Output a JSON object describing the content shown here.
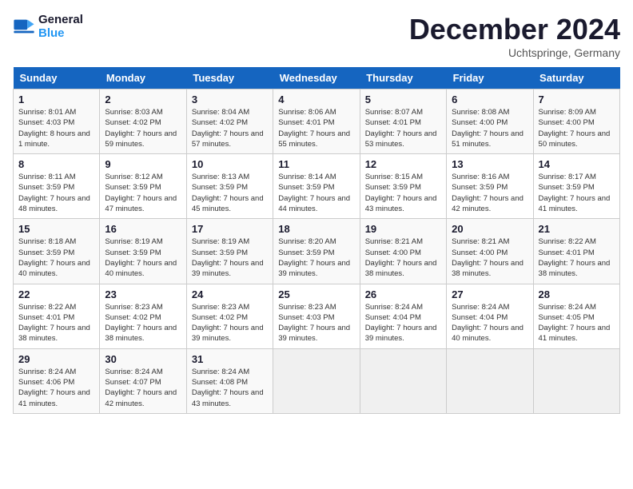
{
  "header": {
    "logo_line1": "General",
    "logo_line2": "Blue",
    "month": "December 2024",
    "location": "Uchtspringe, Germany"
  },
  "days_of_week": [
    "Sunday",
    "Monday",
    "Tuesday",
    "Wednesday",
    "Thursday",
    "Friday",
    "Saturday"
  ],
  "weeks": [
    [
      {
        "day": "1",
        "sunrise": "8:01 AM",
        "sunset": "4:03 PM",
        "daylight": "8 hours and 1 minute."
      },
      {
        "day": "2",
        "sunrise": "8:03 AM",
        "sunset": "4:02 PM",
        "daylight": "7 hours and 59 minutes."
      },
      {
        "day": "3",
        "sunrise": "8:04 AM",
        "sunset": "4:02 PM",
        "daylight": "7 hours and 57 minutes."
      },
      {
        "day": "4",
        "sunrise": "8:06 AM",
        "sunset": "4:01 PM",
        "daylight": "7 hours and 55 minutes."
      },
      {
        "day": "5",
        "sunrise": "8:07 AM",
        "sunset": "4:01 PM",
        "daylight": "7 hours and 53 minutes."
      },
      {
        "day": "6",
        "sunrise": "8:08 AM",
        "sunset": "4:00 PM",
        "daylight": "7 hours and 51 minutes."
      },
      {
        "day": "7",
        "sunrise": "8:09 AM",
        "sunset": "4:00 PM",
        "daylight": "7 hours and 50 minutes."
      }
    ],
    [
      {
        "day": "8",
        "sunrise": "8:11 AM",
        "sunset": "3:59 PM",
        "daylight": "7 hours and 48 minutes."
      },
      {
        "day": "9",
        "sunrise": "8:12 AM",
        "sunset": "3:59 PM",
        "daylight": "7 hours and 47 minutes."
      },
      {
        "day": "10",
        "sunrise": "8:13 AM",
        "sunset": "3:59 PM",
        "daylight": "7 hours and 45 minutes."
      },
      {
        "day": "11",
        "sunrise": "8:14 AM",
        "sunset": "3:59 PM",
        "daylight": "7 hours and 44 minutes."
      },
      {
        "day": "12",
        "sunrise": "8:15 AM",
        "sunset": "3:59 PM",
        "daylight": "7 hours and 43 minutes."
      },
      {
        "day": "13",
        "sunrise": "8:16 AM",
        "sunset": "3:59 PM",
        "daylight": "7 hours and 42 minutes."
      },
      {
        "day": "14",
        "sunrise": "8:17 AM",
        "sunset": "3:59 PM",
        "daylight": "7 hours and 41 minutes."
      }
    ],
    [
      {
        "day": "15",
        "sunrise": "8:18 AM",
        "sunset": "3:59 PM",
        "daylight": "7 hours and 40 minutes."
      },
      {
        "day": "16",
        "sunrise": "8:19 AM",
        "sunset": "3:59 PM",
        "daylight": "7 hours and 40 minutes."
      },
      {
        "day": "17",
        "sunrise": "8:19 AM",
        "sunset": "3:59 PM",
        "daylight": "7 hours and 39 minutes."
      },
      {
        "day": "18",
        "sunrise": "8:20 AM",
        "sunset": "3:59 PM",
        "daylight": "7 hours and 39 minutes."
      },
      {
        "day": "19",
        "sunrise": "8:21 AM",
        "sunset": "4:00 PM",
        "daylight": "7 hours and 38 minutes."
      },
      {
        "day": "20",
        "sunrise": "8:21 AM",
        "sunset": "4:00 PM",
        "daylight": "7 hours and 38 minutes."
      },
      {
        "day": "21",
        "sunrise": "8:22 AM",
        "sunset": "4:01 PM",
        "daylight": "7 hours and 38 minutes."
      }
    ],
    [
      {
        "day": "22",
        "sunrise": "8:22 AM",
        "sunset": "4:01 PM",
        "daylight": "7 hours and 38 minutes."
      },
      {
        "day": "23",
        "sunrise": "8:23 AM",
        "sunset": "4:02 PM",
        "daylight": "7 hours and 38 minutes."
      },
      {
        "day": "24",
        "sunrise": "8:23 AM",
        "sunset": "4:02 PM",
        "daylight": "7 hours and 39 minutes."
      },
      {
        "day": "25",
        "sunrise": "8:23 AM",
        "sunset": "4:03 PM",
        "daylight": "7 hours and 39 minutes."
      },
      {
        "day": "26",
        "sunrise": "8:24 AM",
        "sunset": "4:04 PM",
        "daylight": "7 hours and 39 minutes."
      },
      {
        "day": "27",
        "sunrise": "8:24 AM",
        "sunset": "4:04 PM",
        "daylight": "7 hours and 40 minutes."
      },
      {
        "day": "28",
        "sunrise": "8:24 AM",
        "sunset": "4:05 PM",
        "daylight": "7 hours and 41 minutes."
      }
    ],
    [
      {
        "day": "29",
        "sunrise": "8:24 AM",
        "sunset": "4:06 PM",
        "daylight": "7 hours and 41 minutes."
      },
      {
        "day": "30",
        "sunrise": "8:24 AM",
        "sunset": "4:07 PM",
        "daylight": "7 hours and 42 minutes."
      },
      {
        "day": "31",
        "sunrise": "8:24 AM",
        "sunset": "4:08 PM",
        "daylight": "7 hours and 43 minutes."
      },
      null,
      null,
      null,
      null
    ]
  ]
}
